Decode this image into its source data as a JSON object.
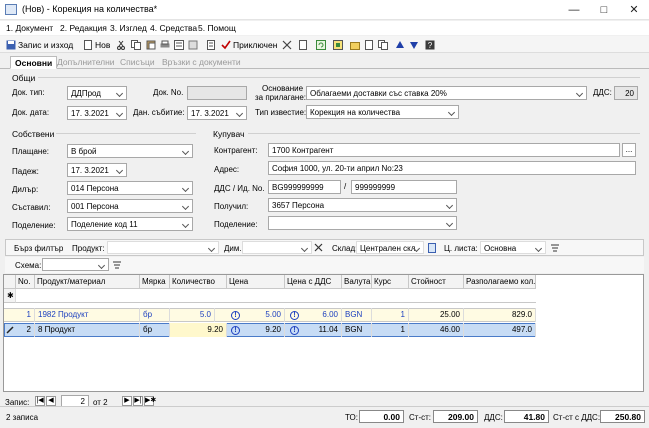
{
  "window": {
    "title": "(Нов) - Корекция на количества*"
  },
  "menu": [
    "1. Документ",
    "2. Редакция",
    "3. Изглед",
    "4. Средства",
    "5. Помощ"
  ],
  "toolbar": {
    "save_exit": "Запис и изход",
    "new": "Нов",
    "apply": "Приключен"
  },
  "tabs": [
    "Основни",
    "Допълнителни",
    "Списъци",
    "Връзки с документи"
  ],
  "general": {
    "group": "Общи",
    "doc_type_label": "Док. тип:",
    "doc_type": "ДДПрод",
    "doc_no_label": "Док. No.",
    "doc_no": "",
    "doc_date_label": "Док. дата:",
    "doc_date": "17. 3.2021",
    "event_date_label": "Дан. събитие:",
    "event_date": "17. 3.2021",
    "basis_label1": "Основание",
    "basis_label2": "за прилагане:",
    "basis": "Облагаеми доставки със ставка 20%",
    "vat_label": "ДДС:",
    "vat": "20",
    "notice_label": "Тип известие:",
    "notice": "Корекция на количества"
  },
  "own": {
    "group": "Собствени",
    "payment_label": "Плащане:",
    "payment": "В брой",
    "due_label": "Падеж:",
    "due": "17. 3.2021",
    "dealer_label": "Дилър:",
    "dealer": "014 Персона",
    "creator_label": "Съставил:",
    "creator": "001 Персона",
    "division_label": "Поделение:",
    "division": "Поделение код 11"
  },
  "buyer": {
    "group": "Купувач",
    "partner_label": "Контрагент:",
    "partner": "1700 Контрагент",
    "address_label": "Адрес:",
    "address": "София 1000, ул. 20-ти април No:23",
    "vat_id_label": "ДДС / Ид. No.",
    "vat_id": "BG999999999",
    "id_no": "999999999",
    "slash": "/",
    "receiver_label": "Получил:",
    "receiver": "3657 Персона",
    "division_label": "Поделение:",
    "division": ""
  },
  "filter": {
    "quick": "Бърз филтър",
    "product_label": "Продукт:",
    "product": "",
    "dim_label": "Дим.",
    "dim": "",
    "warehouse_label": "Склад:",
    "warehouse": "Централен скл",
    "price_list_label": "Ц. листа:",
    "price_list": "Основна",
    "scheme_label": "Схема:",
    "scheme": ""
  },
  "grid": {
    "columns": [
      "No.",
      "Продукт/материал",
      "Мярка",
      "Количество",
      "Цена",
      "Цена с ДДС",
      "Валута",
      "Курс",
      "Стойност",
      "Разполагаемо кол."
    ],
    "new_row_marker": "✱",
    "rows": [
      {
        "no": "1",
        "product": "1982 Продукт",
        "unit": "бр",
        "qty": "5.0",
        "price": "5.00",
        "price_vat": "6.00",
        "currency": "BGN",
        "rate": "1",
        "value": "25.00",
        "available": "829.0"
      },
      {
        "no": "2",
        "product": "8 Продукт",
        "unit": "бр",
        "qty": "9.20",
        "price": "9.20",
        "price_vat": "11.04",
        "currency": "BGN",
        "rate": "1",
        "value": "46.00",
        "available": "497.0"
      }
    ]
  },
  "nav": {
    "label": "Запис:",
    "current": "2",
    "of": "от 2"
  },
  "status": {
    "records": "2 записа",
    "to_label": "ТО:",
    "to": "0.00",
    "net_label": "Ст-ст:",
    "net": "209.00",
    "vat_label": "ДДС:",
    "vat": "41.80",
    "gross_label": "Ст-ст с ДДС:",
    "gross": "250.80"
  },
  "colors": {
    "selected_row": "#c7dcf5",
    "first_row": "#fffbe3",
    "link_blue": "#1c3fbf"
  }
}
